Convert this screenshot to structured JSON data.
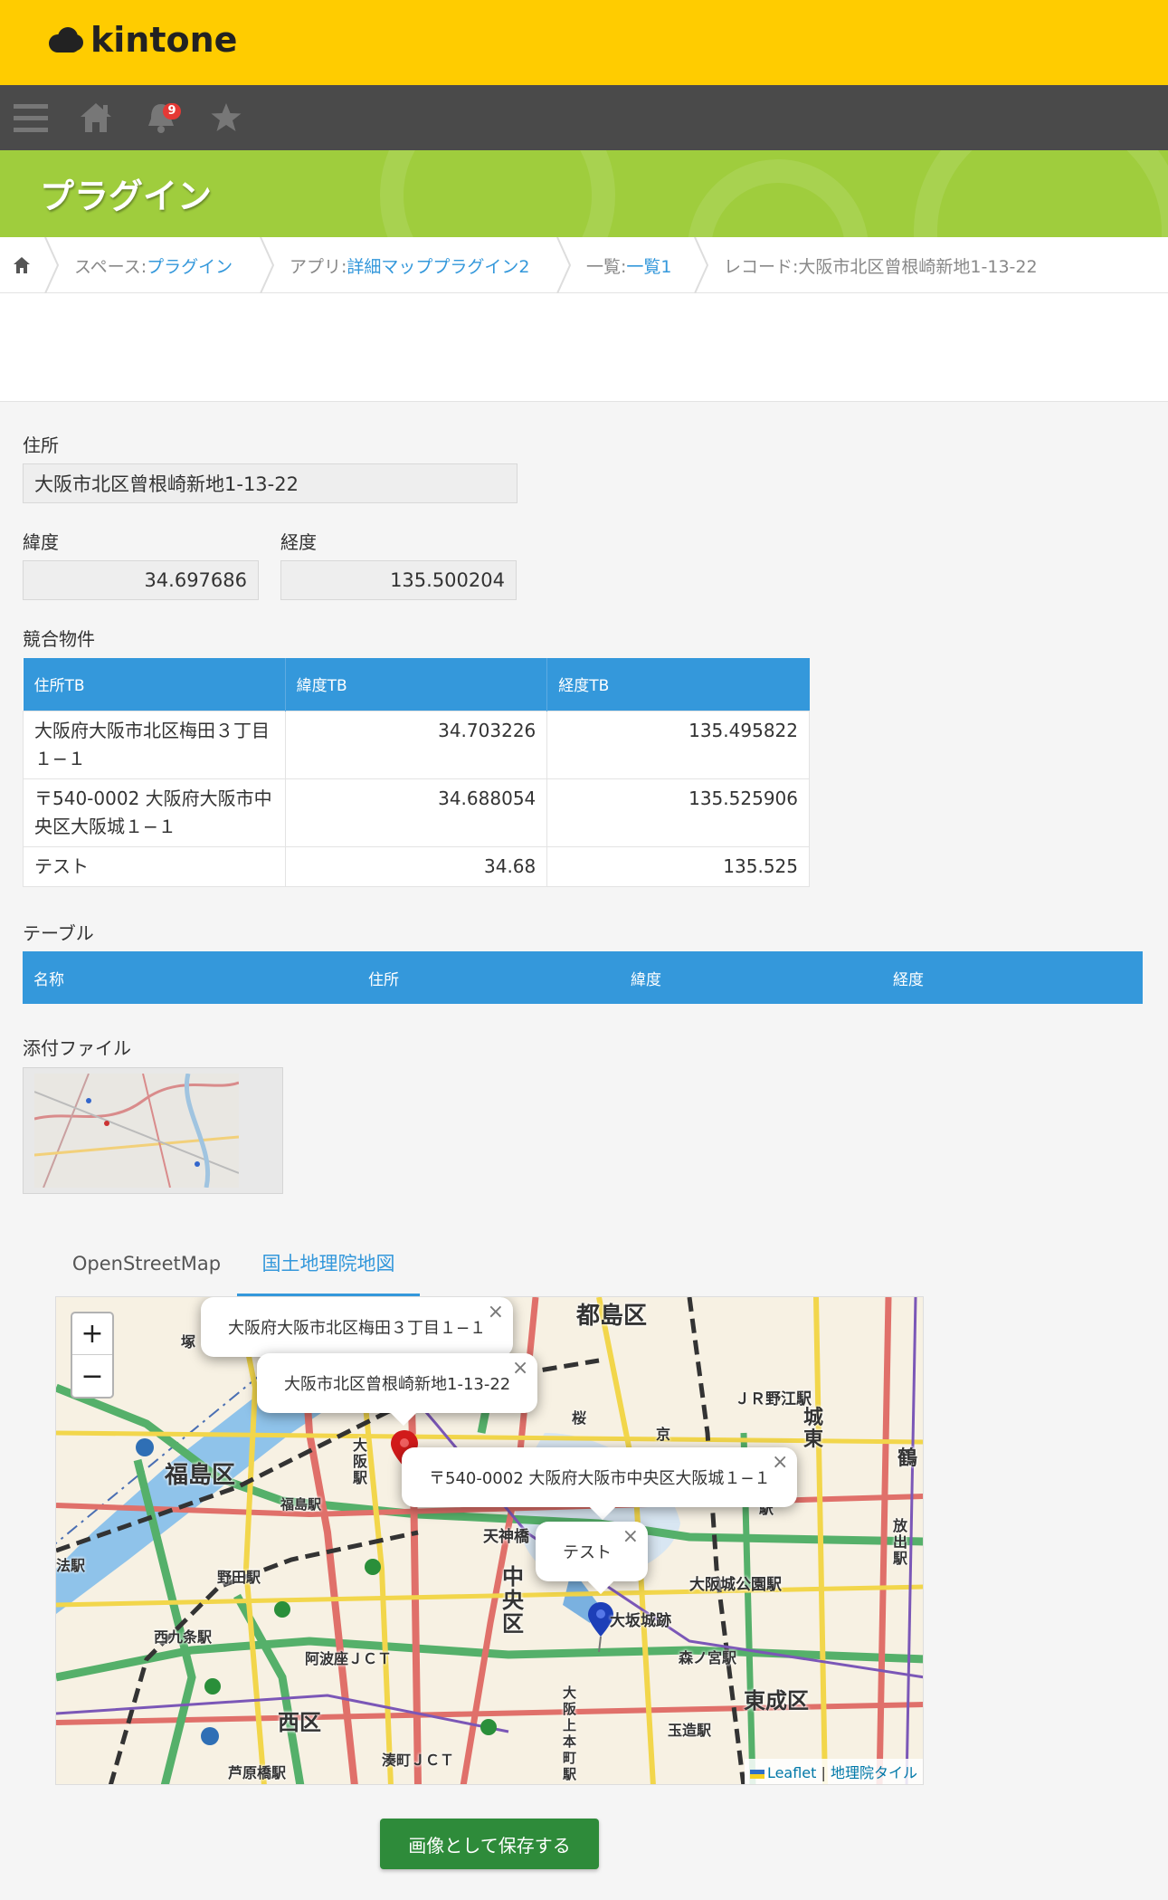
{
  "app": {
    "name": "kintone",
    "notification_count": "9"
  },
  "page_title": "プラグイン",
  "breadcrumb": {
    "space_prefix": "スペース: ",
    "space": "プラグイン",
    "app_prefix": "アプリ: ",
    "app": "詳細マッププラグイン2",
    "list_prefix": "一覧: ",
    "list": "一覧1",
    "record_prefix": "レコード: ",
    "record": "大阪市北区曾根崎新地1-13-22"
  },
  "fields": {
    "address_label": "住所",
    "address_value": "大阪市北区曾根崎新地1-13-22",
    "lat_label": "緯度",
    "lat_value": "34.697686",
    "lng_label": "経度",
    "lng_value": "135.500204"
  },
  "competitors": {
    "label": "競合物件",
    "headers": [
      "住所TB",
      "緯度TB",
      "経度TB"
    ],
    "rows": [
      {
        "address": "大阪府大阪市北区梅田３丁目１−１",
        "lat": "34.703226",
        "lng": "135.495822"
      },
      {
        "address": "〒540-0002 大阪府大阪市中央区大阪城１−１",
        "lat": "34.688054",
        "lng": "135.525906"
      },
      {
        "address": "テスト",
        "lat": "34.68",
        "lng": "135.525"
      }
    ]
  },
  "table2": {
    "label": "テーブル",
    "headers": [
      "名称",
      "住所",
      "緯度",
      "経度"
    ]
  },
  "attachment": {
    "label": "添付ファイル"
  },
  "map_tabs": [
    "OpenStreetMap",
    "国土地理院地図"
  ],
  "active_tab": "国土地理院地図",
  "map": {
    "zoom_in": "+",
    "zoom_out": "−",
    "popups": [
      "大阪府大阪市北区梅田３丁目１−１",
      "大阪市北区曾根崎新地1-13-22",
      "〒540-0002 大阪府大阪市中央区大阪城１−１",
      "テスト"
    ],
    "close": "×",
    "labels": {
      "miyakojima": "都島区",
      "fukushima": "福島区",
      "chuo": "中央区",
      "nishi": "西区",
      "higashinari": "東成区",
      "osakajo": "大坂城跡",
      "osakajokoen": "大阪城公園駅",
      "tenjinbashi": "天神橋",
      "noda": "野田駅",
      "nishikujo": "西九条駅",
      "awaza": "阿波座ＪＣＴ",
      "minatomachi": "湊町ＪＣＴ",
      "morinomiya": "森ノ宮駅",
      "tamatsukuri": "玉造駅",
      "noe": "ＪＲ野江駅",
      "tsuru": "鶴",
      "joto": "城東",
      "osaka_station": "大阪駅",
      "fukushima_station": "福島駅",
      "hojo": "法駅",
      "hanaten": "放出駅",
      "ashiharabashi": "芦原橋駅",
      "osaka_uehon": "大阪上本町駅",
      "tsuka": "塚",
      "kyo": "京",
      "saku": "桜",
      "eki": "駅"
    },
    "attribution_leaflet": "Leaflet",
    "attribution_sep": " | ",
    "attribution_tiles": "地理院タイル"
  },
  "save_button": "画像として保存する",
  "colors": {
    "header": "#ffcc00",
    "nav": "#4a4a4a",
    "page_header": "#9fcd3d",
    "accent": "#3498db",
    "save": "#2e8b3a"
  }
}
